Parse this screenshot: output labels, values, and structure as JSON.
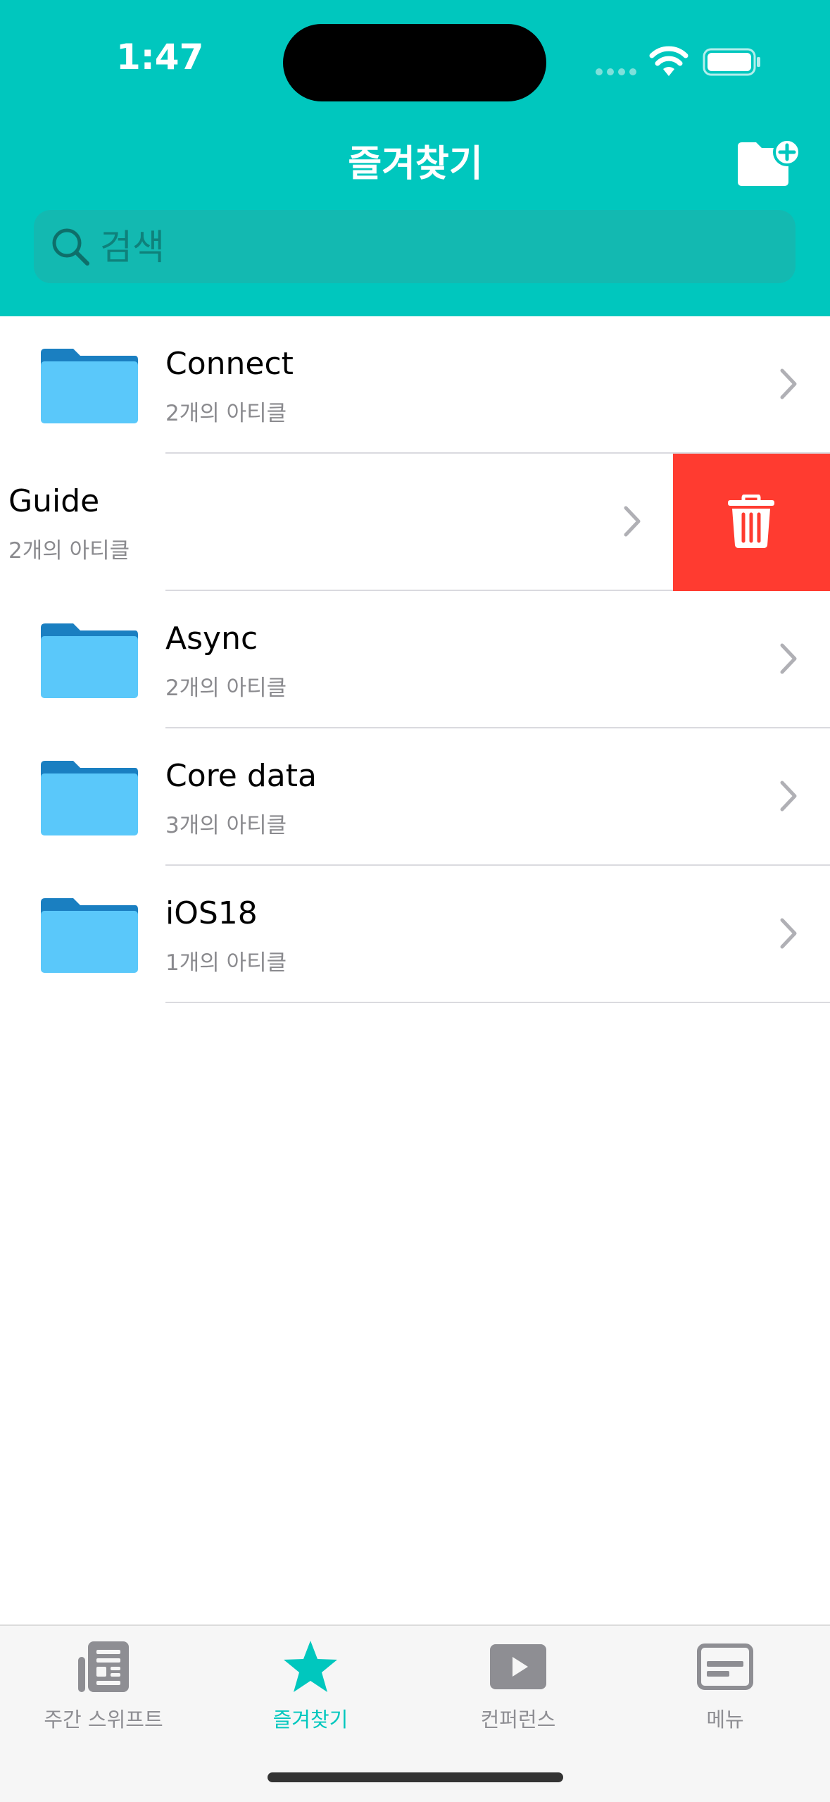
{
  "status_bar": {
    "time": "1:47"
  },
  "nav": {
    "title": "즐겨찾기",
    "add_folder_icon": "folder-plus-icon"
  },
  "search": {
    "placeholder": "검색",
    "value": ""
  },
  "folders": [
    {
      "title": "Connect",
      "subtitle": "2개의 아티클"
    },
    {
      "title": "Guide",
      "subtitle": "2개의 아티클",
      "swiped": true,
      "action": "trash-icon"
    },
    {
      "title": "Async",
      "subtitle": "2개의 아티클"
    },
    {
      "title": "Core data",
      "subtitle": "3개의 아티클"
    },
    {
      "title": "iOS18",
      "subtitle": "1개의 아티클"
    }
  ],
  "tabs": [
    {
      "label": "주간 스위프트",
      "icon": "newspaper-icon",
      "active": false
    },
    {
      "label": "즐겨찾기",
      "icon": "star-icon",
      "active": true
    },
    {
      "label": "컨퍼런스",
      "icon": "play-icon",
      "active": false
    },
    {
      "label": "메뉴",
      "icon": "menu-card-icon",
      "active": false
    }
  ],
  "colors": {
    "accent": "#00C7BE",
    "delete": "#FF3B30",
    "folder": "#5AC8FA",
    "folder_tab": "#1A7FC1",
    "inactive_tab": "#8E8E93"
  }
}
